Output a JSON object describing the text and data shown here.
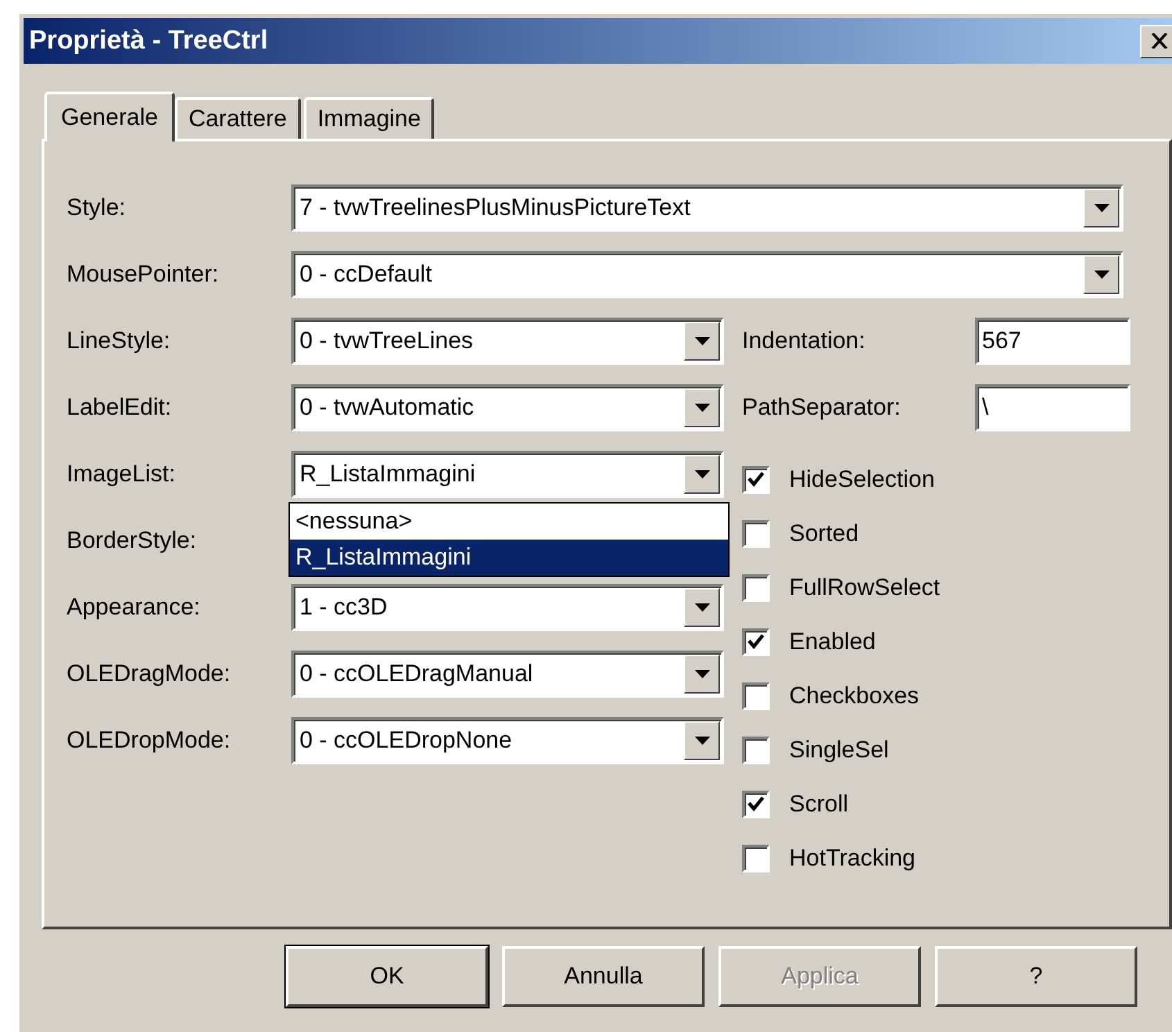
{
  "window": {
    "title": "Proprietà - TreeCtrl"
  },
  "tabs": [
    {
      "label": "Generale",
      "selected": true
    },
    {
      "label": "Carattere",
      "selected": false
    },
    {
      "label": "Immagine",
      "selected": false
    }
  ],
  "wide_fields": [
    {
      "label": "Style:",
      "value": "7 - tvwTreelinesPlusMinusPictureText"
    },
    {
      "label": "MousePointer:",
      "value": "0 - ccDefault"
    }
  ],
  "fields": [
    {
      "label": "LineStyle:",
      "value": "0 - tvwTreeLines"
    },
    {
      "label": "LabelEdit:",
      "value": "0 - tvwAutomatic"
    },
    {
      "label": "ImageList:",
      "value": "R_ListaImmagini",
      "open_list": [
        {
          "label": "<nessuna>",
          "selected": false
        },
        {
          "label": "R_ListaImmagini",
          "selected": true
        }
      ]
    },
    {
      "label": "BorderStyle:"
    },
    {
      "label": "Appearance:",
      "value": "1 - cc3D"
    },
    {
      "label": "OLEDragMode:",
      "value": "0 - ccOLEDragManual"
    },
    {
      "label": "OLEDropMode:",
      "value": "0 - ccOLEDropNone"
    }
  ],
  "text_fields": [
    {
      "label": "Indentation:",
      "value": "567"
    },
    {
      "label": "PathSeparator:",
      "value": "\\"
    }
  ],
  "checkboxes": [
    {
      "label": "HideSelection",
      "checked": true
    },
    {
      "label": "Sorted",
      "checked": false
    },
    {
      "label": "FullRowSelect",
      "checked": false
    },
    {
      "label": "Enabled",
      "checked": true
    },
    {
      "label": "Checkboxes",
      "checked": false
    },
    {
      "label": "SingleSel",
      "checked": false
    },
    {
      "label": "Scroll",
      "checked": true
    },
    {
      "label": "HotTracking",
      "checked": false
    }
  ],
  "buttons": [
    {
      "label": "OK",
      "default": true,
      "disabled": false
    },
    {
      "label": "Annulla",
      "default": false,
      "disabled": false
    },
    {
      "label": "Applica",
      "default": false,
      "disabled": true
    },
    {
      "label": "?",
      "default": false,
      "disabled": false
    }
  ]
}
